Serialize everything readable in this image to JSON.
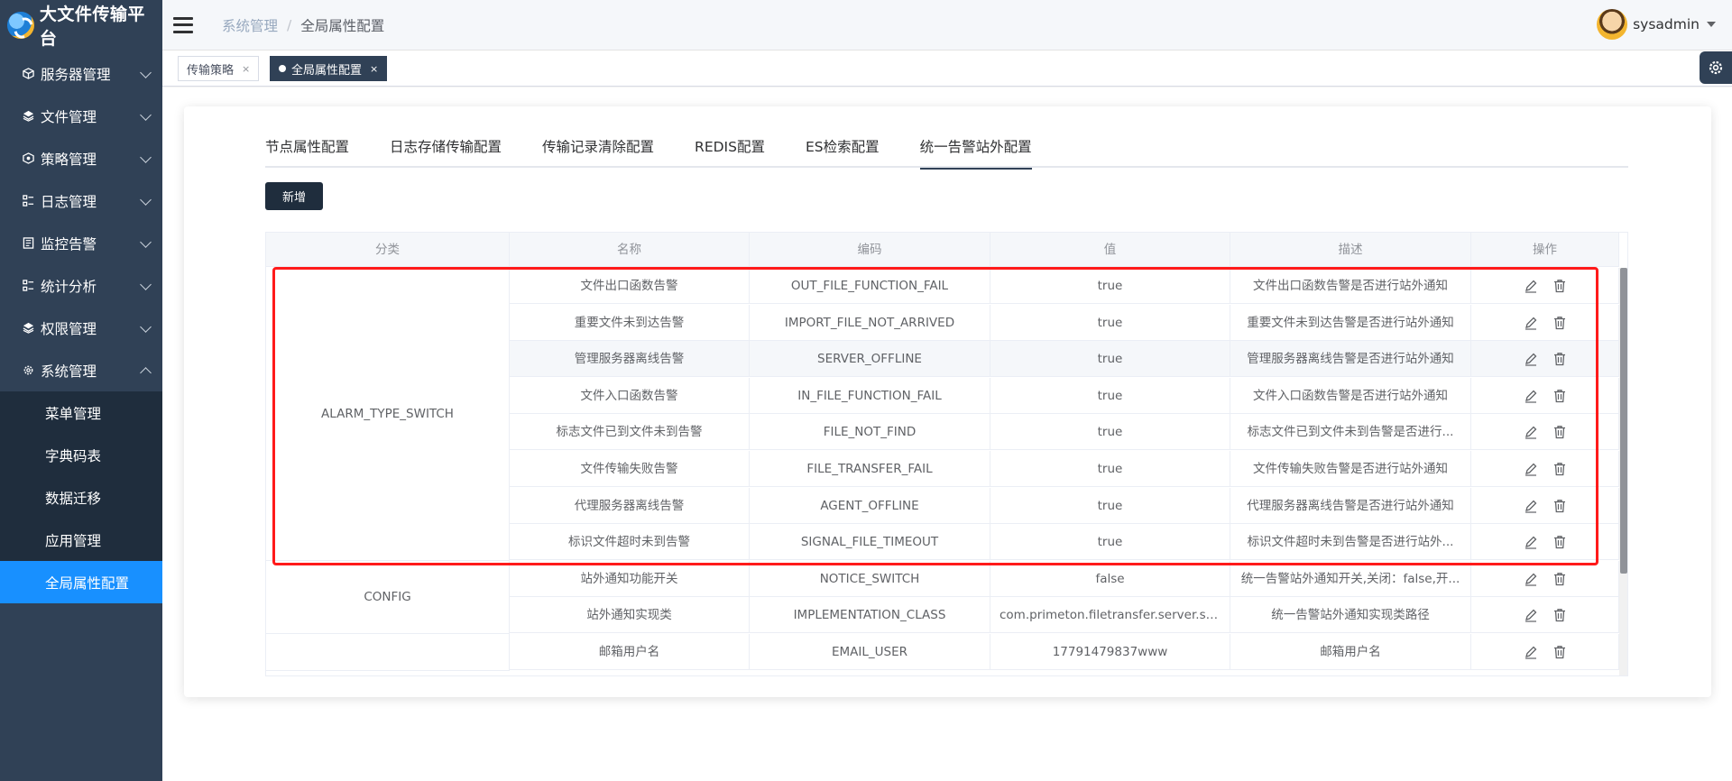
{
  "app": {
    "title": "大文件传输平台"
  },
  "sidebar": {
    "items": [
      {
        "label": "服务器管理",
        "icon": "cube-icon"
      },
      {
        "label": "文件管理",
        "icon": "layers-icon"
      },
      {
        "label": "策略管理",
        "icon": "strategy-icon"
      },
      {
        "label": "日志管理",
        "icon": "log-icon"
      },
      {
        "label": "监控告警",
        "icon": "monitor-icon"
      },
      {
        "label": "统计分析",
        "icon": "chart-icon"
      },
      {
        "label": "权限管理",
        "icon": "permission-icon"
      },
      {
        "label": "系统管理",
        "icon": "gear-icon"
      }
    ],
    "subitems": [
      {
        "label": "菜单管理"
      },
      {
        "label": "字典码表"
      },
      {
        "label": "数据迁移"
      },
      {
        "label": "应用管理"
      },
      {
        "label": "全局属性配置"
      }
    ]
  },
  "header": {
    "breadcrumb": [
      "系统管理",
      "全局属性配置"
    ],
    "username": "sysadmin"
  },
  "tags": [
    {
      "label": "传输策略",
      "close": "×"
    },
    {
      "label": "全局属性配置",
      "close": "×"
    }
  ],
  "tabs": [
    "节点属性配置",
    "日志存储传输配置",
    "传输记录清除配置",
    "REDIS配置",
    "ES检索配置",
    "统一告警站外配置"
  ],
  "actions": {
    "add_label": "新增"
  },
  "table": {
    "headers": [
      "分类",
      "名称",
      "编码",
      "值",
      "描述",
      "操作"
    ],
    "groups": [
      {
        "category": "ALARM_TYPE_SWITCH"
      },
      {
        "category": "CONFIG"
      },
      {
        "category": ""
      }
    ],
    "rows": [
      {
        "name": "文件出口函数告警",
        "code": "OUT_FILE_FUNCTION_FAIL",
        "value": "true",
        "desc": "文件出口函数告警是否进行站外通知"
      },
      {
        "name": "重要文件未到达告警",
        "code": "IMPORT_FILE_NOT_ARRIVED",
        "value": "true",
        "desc": "重要文件未到达告警是否进行站外通知"
      },
      {
        "name": "管理服务器离线告警",
        "code": "SERVER_OFFLINE",
        "value": "true",
        "desc": "管理服务器离线告警是否进行站外通知"
      },
      {
        "name": "文件入口函数告警",
        "code": "IN_FILE_FUNCTION_FAIL",
        "value": "true",
        "desc": "文件入口函数告警是否进行站外通知"
      },
      {
        "name": "标志文件已到文件未到告警",
        "code": "FILE_NOT_FIND",
        "value": "true",
        "desc": "标志文件已到文件未到告警是否进行..."
      },
      {
        "name": "文件传输失败告警",
        "code": "FILE_TRANSFER_FAIL",
        "value": "true",
        "desc": "文件传输失败告警是否进行站外通知"
      },
      {
        "name": "代理服务器离线告警",
        "code": "AGENT_OFFLINE",
        "value": "true",
        "desc": "代理服务器离线告警是否进行站外通知"
      },
      {
        "name": "标识文件超时未到告警",
        "code": "SIGNAL_FILE_TIMEOUT",
        "value": "true",
        "desc": "标识文件超时未到告警是否进行站外..."
      },
      {
        "name": "站外通知功能开关",
        "code": "NOTICE_SWITCH",
        "value": "false",
        "desc": "统一告警站外通知开关,关闭：false,开..."
      },
      {
        "name": "站外通知实现类",
        "code": "IMPLEMENTATION_CLASS",
        "value": "com.primeton.filetransfer.server.servi...",
        "desc": "统一告警站外通知实现类路径"
      },
      {
        "name": "邮箱用户名",
        "code": "EMAIL_USER",
        "value": "17791479837www",
        "desc": "邮箱用户名"
      }
    ]
  },
  "colors": {
    "sidebar_bg": "#304156",
    "active_menu": "#1890ff",
    "highlight_box": "#ff1a1a"
  }
}
